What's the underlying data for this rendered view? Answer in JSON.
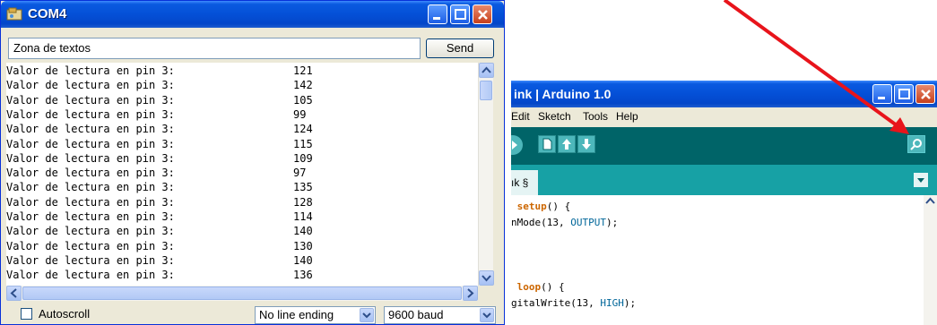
{
  "serial_monitor": {
    "title": "COM4",
    "input_value": "Zona de textos",
    "send_label": "Send",
    "log": [
      {
        "label": "Valor de lectura en pin 3:",
        "value": "121"
      },
      {
        "label": "Valor de lectura en pin 3:",
        "value": "142"
      },
      {
        "label": "Valor de lectura en pin 3:",
        "value": "105"
      },
      {
        "label": "Valor de lectura en pin 3:",
        "value": "99"
      },
      {
        "label": "Valor de lectura en pin 3:",
        "value": "124"
      },
      {
        "label": "Valor de lectura en pin 3:",
        "value": "115"
      },
      {
        "label": "Valor de lectura en pin 3:",
        "value": "109"
      },
      {
        "label": "Valor de lectura en pin 3:",
        "value": "97"
      },
      {
        "label": "Valor de lectura en pin 3:",
        "value": "135"
      },
      {
        "label": "Valor de lectura en pin 3:",
        "value": "128"
      },
      {
        "label": "Valor de lectura en pin 3:",
        "value": "114"
      },
      {
        "label": "Valor de lectura en pin 3:",
        "value": "140"
      },
      {
        "label": "Valor de lectura en pin 3:",
        "value": "130"
      },
      {
        "label": "Valor de lectura en pin 3:",
        "value": "140"
      },
      {
        "label": "Valor de lectura en pin 3:",
        "value": "136"
      }
    ],
    "autoscroll_label": "Autoscroll",
    "line_ending": "No line ending",
    "baud_rate": "9600 baud"
  },
  "ide": {
    "title": "ink | Arduino 1.0",
    "menu": [
      "Edit",
      "Sketch",
      "Tools",
      "Help"
    ],
    "tab_label": "ık §",
    "code": {
      "setup_kw": "setup",
      "setup_rest": "() {",
      "pinmode_text": "nMode(13, ",
      "output_kw": "OUTPUT",
      "pinmode_end": ");",
      "loop_kw": "loop",
      "loop_rest": "() {",
      "digitalwrite_text": "gitalWrite(13, ",
      "high_kw": "HIGH",
      "digitalwrite_end": ");"
    }
  },
  "colors": {
    "title_blue": "#0450d7",
    "ide_toolbar": "#006468",
    "ide_tabs": "#17a1a5",
    "arrow": "#e8141b"
  }
}
